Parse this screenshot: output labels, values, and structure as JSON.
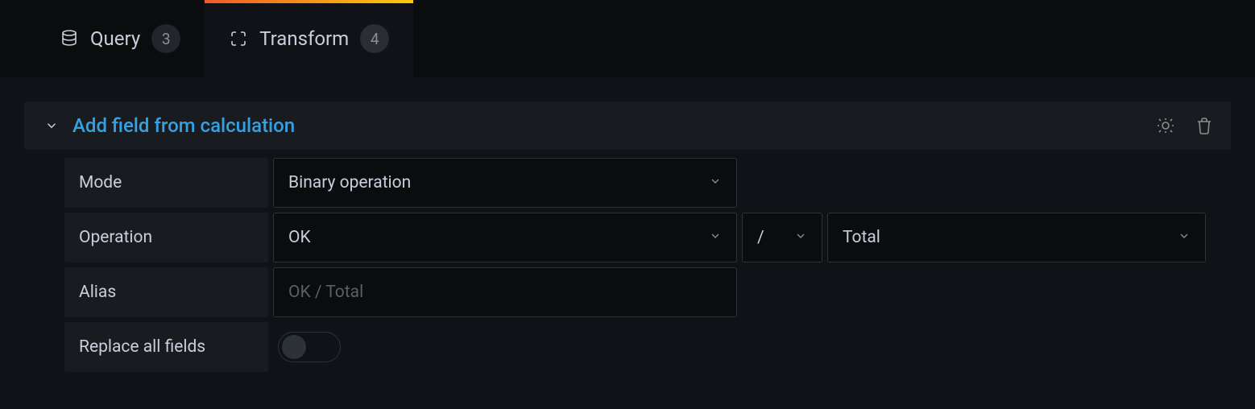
{
  "tabs": {
    "query": {
      "label": "Query",
      "count": "3"
    },
    "transform": {
      "label": "Transform",
      "count": "4"
    }
  },
  "transform_block": {
    "title": "Add field from calculation"
  },
  "form": {
    "mode": {
      "label": "Mode",
      "value": "Binary operation"
    },
    "operation": {
      "label": "Operation",
      "left": "OK",
      "operator": "/",
      "right": "Total"
    },
    "alias": {
      "label": "Alias",
      "placeholder": "OK / Total"
    },
    "replace": {
      "label": "Replace all fields"
    }
  }
}
